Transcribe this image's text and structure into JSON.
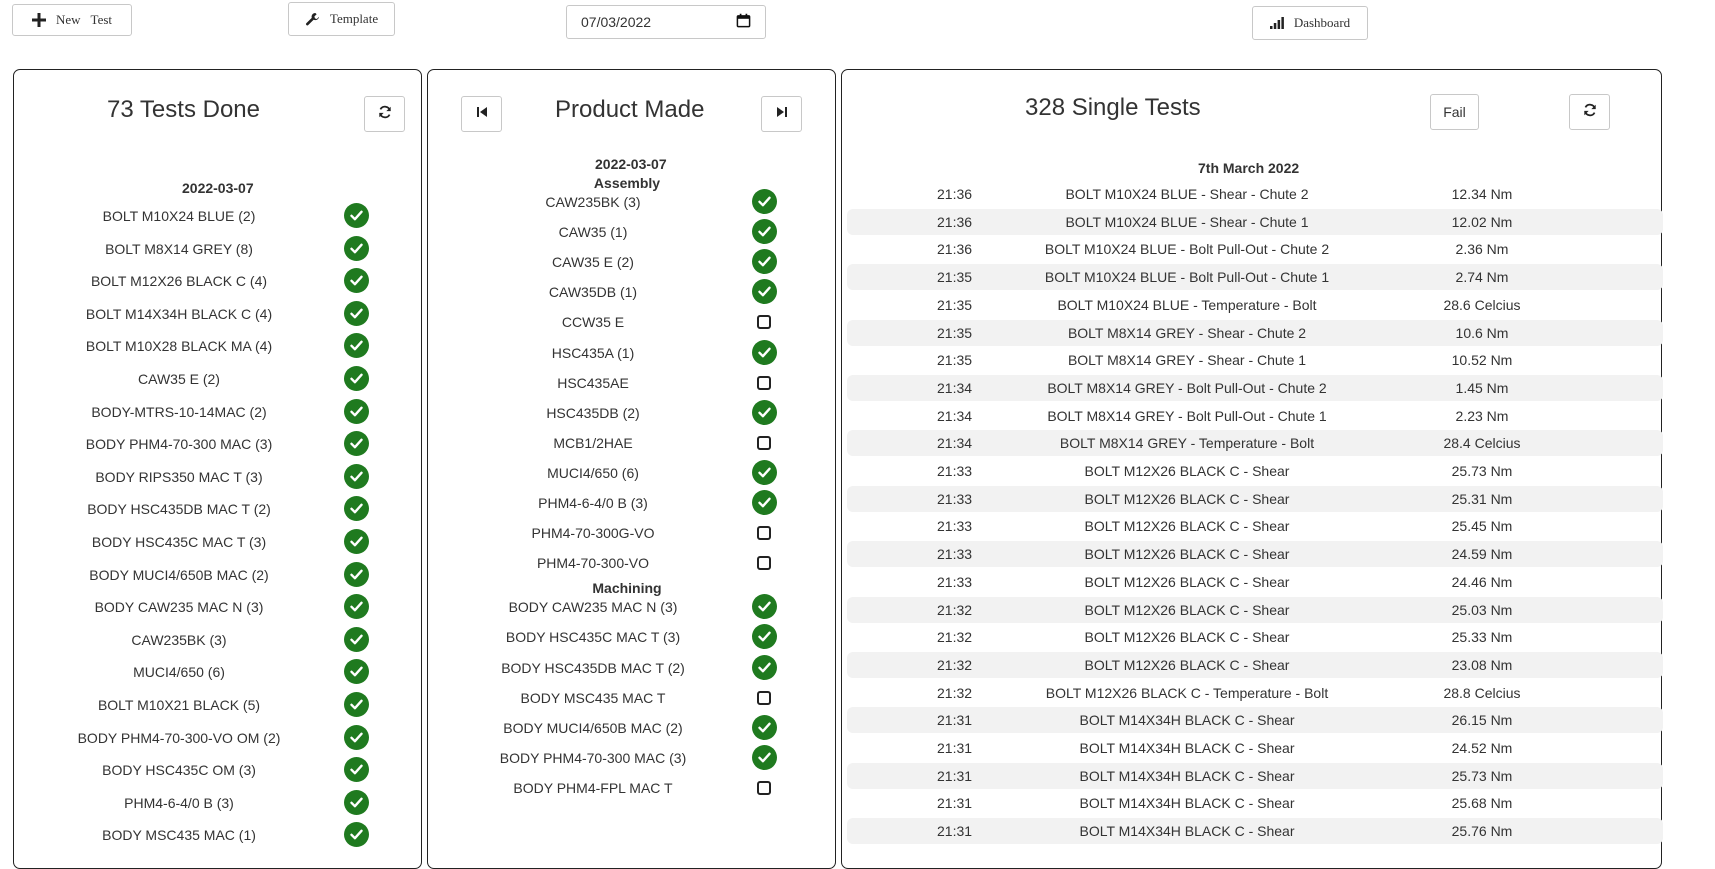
{
  "toolbar": {
    "new_test_label_a": "New",
    "new_test_label_b": "Test",
    "template_label": "Template",
    "date_value": "07/03/2022",
    "dashboard_label": "Dashboard"
  },
  "tests_done": {
    "title": "73 Tests Done",
    "date": "2022-03-07",
    "items": [
      {
        "label": "BOLT M10X24 BLUE (2)",
        "done": true
      },
      {
        "label": "BOLT M8X14 GREY (8)",
        "done": true
      },
      {
        "label": "BOLT M12X26 BLACK C (4)",
        "done": true
      },
      {
        "label": "BOLT M14X34H BLACK C (4)",
        "done": true
      },
      {
        "label": "BOLT M10X28 BLACK MA (4)",
        "done": true
      },
      {
        "label": "CAW35 E (2)",
        "done": true
      },
      {
        "label": "BODY-MTRS-10-14MAC (2)",
        "done": true
      },
      {
        "label": "BODY PHM4-70-300 MAC (3)",
        "done": true
      },
      {
        "label": "BODY RIPS350 MAC T (3)",
        "done": true
      },
      {
        "label": "BODY HSC435DB MAC T (2)",
        "done": true
      },
      {
        "label": "BODY HSC435C MAC T (3)",
        "done": true
      },
      {
        "label": "BODY MUCI4/650B MAC (2)",
        "done": true
      },
      {
        "label": "BODY CAW235 MAC N (3)",
        "done": true
      },
      {
        "label": "CAW235BK (3)",
        "done": true
      },
      {
        "label": "MUCI4/650 (6)",
        "done": true
      },
      {
        "label": "BOLT M10X21 BLACK (5)",
        "done": true
      },
      {
        "label": "BODY PHM4-70-300-VO OM (2)",
        "done": true
      },
      {
        "label": "BODY HSC435C OM (3)",
        "done": true
      },
      {
        "label": "PHM4-6-4/0 B (3)",
        "done": true
      },
      {
        "label": "BODY MSC435 MAC (1)",
        "done": true
      }
    ]
  },
  "product_made": {
    "title": "Product Made",
    "date": "2022-03-07",
    "sections": [
      {
        "name": "Assembly",
        "items": [
          {
            "label": "CAW235BK (3)",
            "done": true
          },
          {
            "label": "CAW35 (1)",
            "done": true
          },
          {
            "label": "CAW35 E (2)",
            "done": true
          },
          {
            "label": "CAW35DB (1)",
            "done": true
          },
          {
            "label": "CCW35 E",
            "done": false
          },
          {
            "label": "HSC435A (1)",
            "done": true
          },
          {
            "label": "HSC435AE",
            "done": false
          },
          {
            "label": "HSC435DB (2)",
            "done": true
          },
          {
            "label": "MCB1/2HAE",
            "done": false
          },
          {
            "label": "MUCI4/650 (6)",
            "done": true
          },
          {
            "label": "PHM4-6-4/0 B (3)",
            "done": true
          },
          {
            "label": "PHM4-70-300G-VO",
            "done": false
          },
          {
            "label": "PHM4-70-300-VO",
            "done": false
          }
        ]
      },
      {
        "name": "Machining",
        "items": [
          {
            "label": "BODY CAW235 MAC N (3)",
            "done": true
          },
          {
            "label": "BODY HSC435C MAC T (3)",
            "done": true
          },
          {
            "label": "BODY HSC435DB MAC T (2)",
            "done": true
          },
          {
            "label": "BODY MSC435 MAC T",
            "done": false
          },
          {
            "label": "BODY MUCI4/650B MAC (2)",
            "done": true
          },
          {
            "label": "BODY PHM4-70-300 MAC (3)",
            "done": true
          },
          {
            "label": "BODY PHM4-FPL MAC T",
            "done": false
          }
        ]
      }
    ]
  },
  "single_tests": {
    "title": "328 Single Tests",
    "fail_label": "Fail",
    "date": "7th March 2022",
    "rows": [
      {
        "time": "21:36",
        "desc": "BOLT M10X24 BLUE - Shear - Chute 2",
        "value": "12.34 Nm"
      },
      {
        "time": "21:36",
        "desc": "BOLT M10X24 BLUE - Shear - Chute 1",
        "value": "12.02 Nm"
      },
      {
        "time": "21:36",
        "desc": "BOLT M10X24 BLUE - Bolt Pull-Out - Chute 2",
        "value": "2.36 Nm"
      },
      {
        "time": "21:35",
        "desc": "BOLT M10X24 BLUE - Bolt Pull-Out - Chute 1",
        "value": "2.74 Nm"
      },
      {
        "time": "21:35",
        "desc": "BOLT M10X24 BLUE - Temperature - Bolt",
        "value": "28.6 Celcius"
      },
      {
        "time": "21:35",
        "desc": "BOLT M8X14 GREY - Shear - Chute 2",
        "value": "10.6 Nm"
      },
      {
        "time": "21:35",
        "desc": "BOLT M8X14 GREY - Shear - Chute 1",
        "value": "10.52 Nm"
      },
      {
        "time": "21:34",
        "desc": "BOLT M8X14 GREY - Bolt Pull-Out - Chute 2",
        "value": "1.45 Nm"
      },
      {
        "time": "21:34",
        "desc": "BOLT M8X14 GREY - Bolt Pull-Out - Chute 1",
        "value": "2.23 Nm"
      },
      {
        "time": "21:34",
        "desc": "BOLT M8X14 GREY - Temperature - Bolt",
        "value": "28.4 Celcius"
      },
      {
        "time": "21:33",
        "desc": "BOLT M12X26 BLACK C - Shear",
        "value": "25.73 Nm"
      },
      {
        "time": "21:33",
        "desc": "BOLT M12X26 BLACK C - Shear",
        "value": "25.31 Nm"
      },
      {
        "time": "21:33",
        "desc": "BOLT M12X26 BLACK C - Shear",
        "value": "25.45 Nm"
      },
      {
        "time": "21:33",
        "desc": "BOLT M12X26 BLACK C - Shear",
        "value": "24.59 Nm"
      },
      {
        "time": "21:33",
        "desc": "BOLT M12X26 BLACK C - Shear",
        "value": "24.46 Nm"
      },
      {
        "time": "21:32",
        "desc": "BOLT M12X26 BLACK C - Shear",
        "value": "25.03 Nm"
      },
      {
        "time": "21:32",
        "desc": "BOLT M12X26 BLACK C - Shear",
        "value": "25.33 Nm"
      },
      {
        "time": "21:32",
        "desc": "BOLT M12X26 BLACK C - Shear",
        "value": "23.08 Nm"
      },
      {
        "time": "21:32",
        "desc": "BOLT M12X26 BLACK C - Temperature - Bolt",
        "value": "28.8 Celcius"
      },
      {
        "time": "21:31",
        "desc": "BOLT M14X34H BLACK C - Shear",
        "value": "26.15 Nm"
      },
      {
        "time": "21:31",
        "desc": "BOLT M14X34H BLACK C - Shear",
        "value": "24.52 Nm"
      },
      {
        "time": "21:31",
        "desc": "BOLT M14X34H BLACK C - Shear",
        "value": "25.73 Nm"
      },
      {
        "time": "21:31",
        "desc": "BOLT M14X34H BLACK C - Shear",
        "value": "25.68 Nm"
      },
      {
        "time": "21:31",
        "desc": "BOLT M14X34H BLACK C - Shear",
        "value": "25.76 Nm"
      }
    ]
  },
  "colors": {
    "check_green": "#1f7a1f",
    "alt_row": "#f2f2f2",
    "panel_border": "#222222"
  }
}
